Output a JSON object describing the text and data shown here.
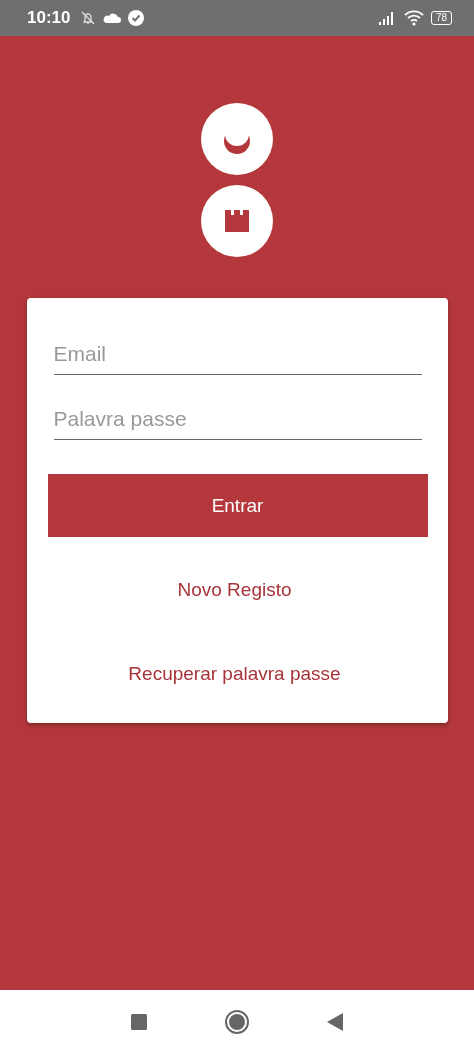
{
  "status_bar": {
    "time": "10:10",
    "battery": "78"
  },
  "form": {
    "fields": [
      {
        "placeholder": "Email"
      },
      {
        "placeholder": "Palavra passe"
      }
    ],
    "submit": "Entrar",
    "links": [
      "Novo Registo",
      "Recuperar palavra passe"
    ]
  }
}
